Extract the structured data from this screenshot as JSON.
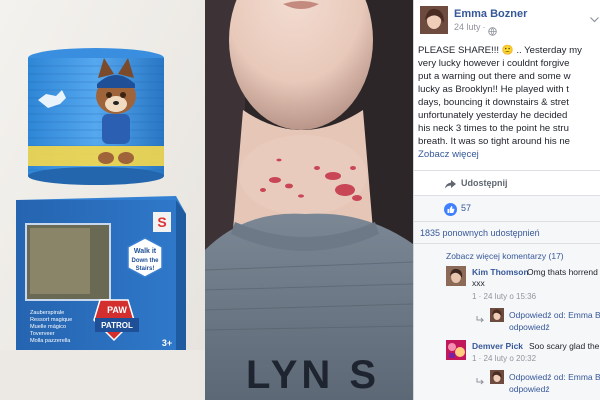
{
  "product": {
    "paw_logo_paw": "PAW",
    "paw_logo_patrol": "PATROL",
    "badge_walk": "Walk it",
    "badge_down": "Down the",
    "badge_stairs": "Stairs!",
    "age": "3+",
    "brand_letter": "S",
    "langs": [
      "Zauberspirale",
      "Ressort magique",
      "Muelle mágico",
      "Toverveer",
      "Molla pazzerella"
    ]
  },
  "shirt_print": "LYN  S",
  "post": {
    "author": "Emma Bozner",
    "date": "24 luty",
    "date_sep": "·",
    "text_lines": [
      "PLEASE SHARE!!! 🙁 .. Yesterday my",
      "very lucky however i couldnt forgive",
      "put a warning out there and some w",
      "lucky as Brooklyn!! He played with t",
      "days, bouncing it downstairs & stret",
      "unfortunately yesterday he decided",
      "his neck 3 times to the point he stru",
      "breath. It was so tight around his ne"
    ],
    "see_more": "Zobacz więcej",
    "share_label": "Udostępnij",
    "reaction_count": "57",
    "shares_text": "1835 ponownych udostępnień",
    "more_comments": "Zobacz więcej komentarzy (17)"
  },
  "comments": [
    {
      "name": "Kim Thomson",
      "text": "Omg thats horrend",
      "text2": "xxx",
      "meta": "1 · 24 luty o 15:36",
      "reply_text": "Odpowiedź od: Emma B",
      "reply_text2": "odpowiedź"
    },
    {
      "name": "Demver Pick",
      "text": "Soo scary glad the",
      "meta": "1 · 24 luty o 20:32",
      "reply_text": "Odpowiedź od: Emma B",
      "reply_text2": "odpowiedź"
    }
  ],
  "icons": {
    "globe": "globe-icon",
    "chevron": "chevron-down-icon",
    "share": "share-arrow-icon",
    "like": "like-thumb-icon",
    "reply": "reply-arrow-icon"
  },
  "colors": {
    "fb_link": "#365899",
    "like_blue": "#4080ff",
    "box_blue": "#2a73c4"
  }
}
